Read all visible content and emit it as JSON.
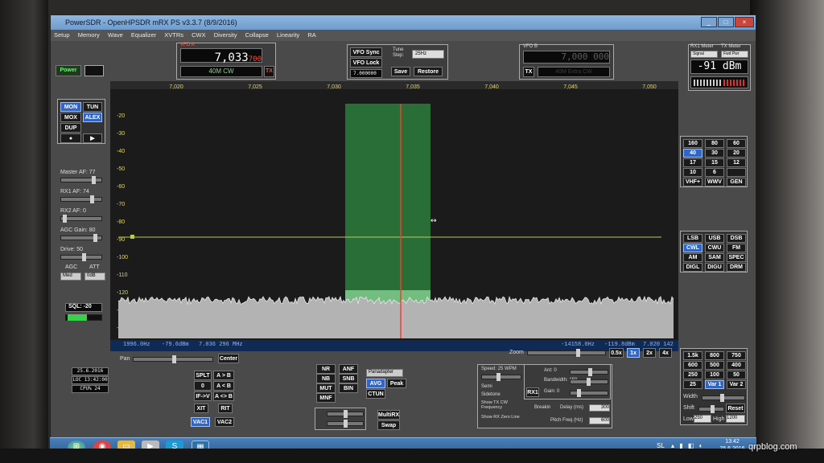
{
  "window": {
    "title": "PowerSDR - OpenHPSDR mRX PS v3.3.7 (8/9/2016)"
  },
  "menu": [
    "Setup",
    "Memory",
    "Wave",
    "Equalizer",
    "XVTRs",
    "CWX",
    "Diversity",
    "Collapse",
    "Linearity",
    "RA"
  ],
  "power_button": "Power",
  "vfoa": {
    "title": "VFO A",
    "freq": "7,033",
    "freq_small": "700",
    "tx": "TX",
    "band": "40M CW"
  },
  "vfo_controls": {
    "sync": "VFO Sync",
    "lock": "VFO Lock",
    "tune_step_label": "Tune Step:",
    "tune_step": "25Hz",
    "save": "Save",
    "restore": "Restore",
    "memory_freq": "7.000000"
  },
  "vfob": {
    "title": "VFO B",
    "freq": "7,000 000",
    "tx": "TX",
    "band": "40M Extra CW"
  },
  "meter": {
    "rx1_label": "RX1 Meter",
    "tx_label": "TX Meter",
    "rx_mode": "Signal",
    "tx_mode": "Fwd Pwr",
    "reading": "-91 dBm"
  },
  "freq_axis": [
    "7,020",
    "7,025",
    "7,030",
    "7,035",
    "7,040",
    "7,045",
    "7,050"
  ],
  "db_axis": [
    "-20",
    "-30",
    "-40",
    "-50",
    "-60",
    "-70",
    "-80",
    "-90",
    "-100",
    "-110",
    "-120",
    "-130",
    "-140"
  ],
  "readout": {
    "left1": "1996.0Hz",
    "left2": "-79.6dBm",
    "left3": "7.036 296 MHz",
    "right1": "-14158.0Hz",
    "right2": "-119.8dBm",
    "right3": "7.020 142 MHz"
  },
  "left_panel": {
    "mon": "MON",
    "tun": "TUN",
    "mox": "MOX",
    "alex": "ALEX",
    "dup": "DUP",
    "master_af": "Master AF: 77",
    "rx1_af": "RX1 AF: 74",
    "rx2_af": "RX2 AF: 0",
    "agc_gain": "AGC Gain: 80",
    "drive": "Drive: 50",
    "agc": "AGC",
    "att": "ATT",
    "agc_val": "Med",
    "att_val": "0dB",
    "sql": "SQL: -20"
  },
  "bands": [
    "160",
    "80",
    "60",
    "40",
    "30",
    "20",
    "17",
    "15",
    "12",
    "10",
    "6",
    "",
    "VHF+",
    "WWV",
    "GEN"
  ],
  "modes": [
    "LSB",
    "USB",
    "DSB",
    "CWL",
    "CWU",
    "FM",
    "AM",
    "SAM",
    "SPEC",
    "DIGL",
    "DIGU",
    "DRM"
  ],
  "filters": [
    "1.5k",
    "800",
    "750",
    "600",
    "500",
    "400",
    "250",
    "100",
    "50",
    "25",
    "Var 1",
    "Var 2"
  ],
  "filter_labels": {
    "width": "Width",
    "shift": "Shift",
    "reset": "Reset",
    "low": "Low",
    "high": "High",
    "low_val": "250",
    "high_val": "1200"
  },
  "bottom_left": {
    "date": "25.6.2016",
    "time": "LOC 13:42:00",
    "cpu": "CPU% 24",
    "pan": "Pan",
    "center": "Center"
  },
  "split": {
    "splt": "SPLT",
    "ab": "A > B",
    "zbeat": "0 Beat",
    "ba": "A < B",
    "ifv": "IF->V",
    "swap": "A <> B",
    "xit": "XIT",
    "rit": "RIT",
    "vac1": "VAC1",
    "vac2": "VAC2"
  },
  "dsp": {
    "nr": "NR",
    "anf": "ANF",
    "nb": "NB",
    "snb": "SNB",
    "mut": "MUT",
    "bin": "BIN",
    "mnf": "MNF",
    "avg": "AVG",
    "peak": "Peak",
    "ctun": "CTUN",
    "multirx": "MultiRX",
    "swap": "Swap",
    "display": "Panadapter"
  },
  "zoom": {
    "label": "Zoom",
    "z05": "0.5x",
    "z1": "1x",
    "z2": "2x",
    "z4": "4x"
  },
  "cw": {
    "speed": "Speed: 25 WPM",
    "semi": "Semi",
    "sidetone": "Sidetone",
    "show_tx": "Show TX CW Frequency",
    "show_rx": "Show RX Zero Line",
    "break_in": "Breakin",
    "delay_label": "Delay (ms)",
    "delay": "300",
    "pitch_label": "Pitch Freq (Hz)",
    "pitch": "600",
    "rx1": "RX1",
    "gain": "Gain: 0",
    "bandwidth": "Bandwidth: 150",
    "ant": "Ant: 0"
  },
  "taskbar": {
    "lang": "SL",
    "time": "13:42",
    "date": "25.6.2016"
  },
  "watermark": "qrpblog.com"
}
